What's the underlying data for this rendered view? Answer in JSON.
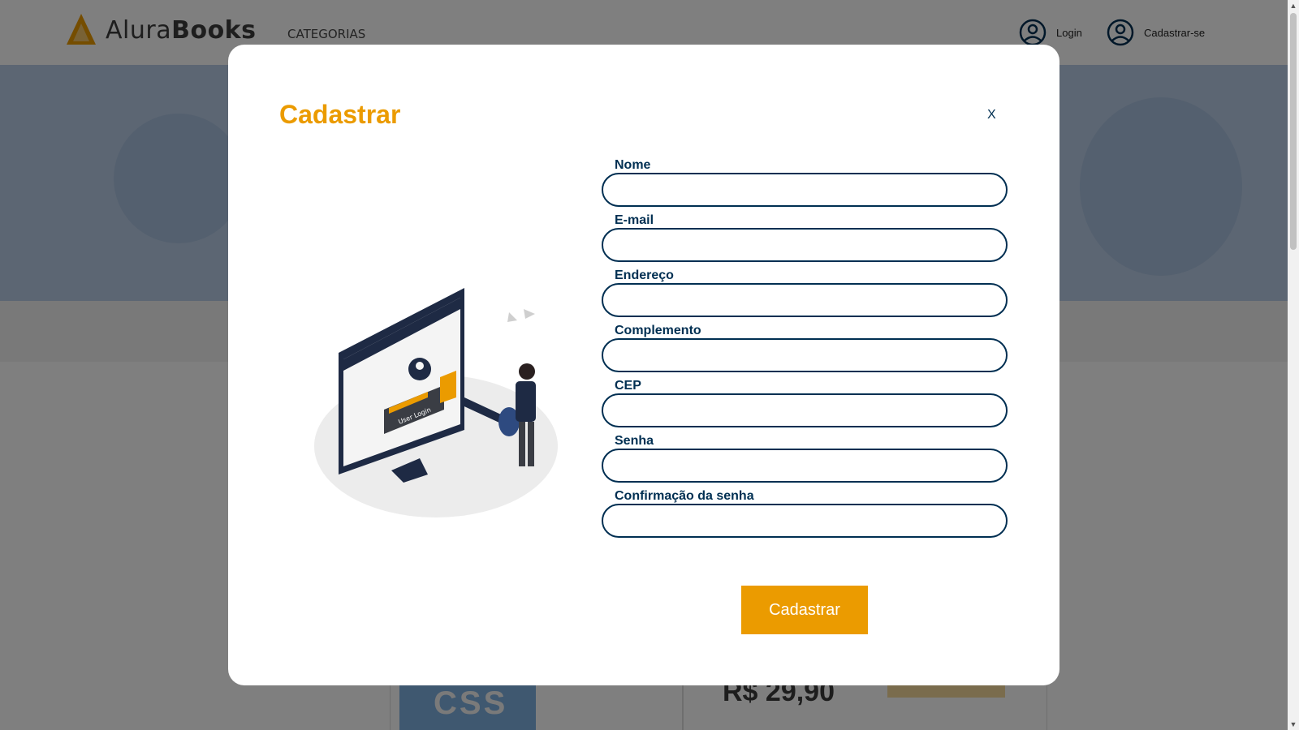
{
  "header": {
    "logo_text_regular": "Alura",
    "logo_text_bold": "Books",
    "nav_categories": "CATEGORIAS",
    "login_label": "Login",
    "signup_label": "Cadastrar-se"
  },
  "background": {
    "book_cover_text": "CSS",
    "price": "R$ 29,90"
  },
  "modal": {
    "title": "Cadastrar",
    "close_label": "X",
    "fields": [
      {
        "label": "Nome",
        "value": "",
        "placeholder": ""
      },
      {
        "label": "E-mail",
        "value": "",
        "placeholder": ""
      },
      {
        "label": "Endereço",
        "value": "",
        "placeholder": ""
      },
      {
        "label": "Complemento",
        "value": "",
        "placeholder": ""
      },
      {
        "label": "CEP",
        "value": "",
        "placeholder": ""
      },
      {
        "label": "Senha",
        "value": "",
        "placeholder": ""
      },
      {
        "label": "Confirmação da senha",
        "value": "",
        "placeholder": ""
      }
    ],
    "submit_label": "Cadastrar",
    "illustration_text": "User Login"
  },
  "colors": {
    "accent": "#eb9b00",
    "primary_text": "#002f52",
    "overlay": "rgba(0,0,0,0.5)"
  },
  "icons": [
    "alurabooks-logo-icon",
    "user-circle-icon",
    "close-icon",
    "user-login-illustration"
  ]
}
